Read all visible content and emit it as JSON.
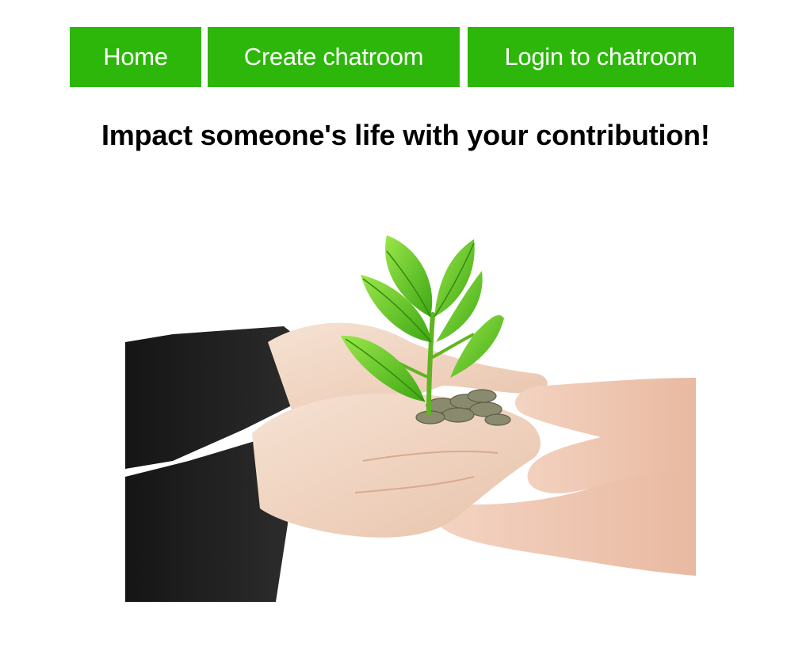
{
  "nav": {
    "items": [
      {
        "label": "Home"
      },
      {
        "label": "Create chatroom"
      },
      {
        "label": "Login to chatroom"
      }
    ]
  },
  "main": {
    "headline": "Impact someone's life with your contribution!",
    "hero_image": {
      "icon": "seedling-in-hands-illustration"
    }
  },
  "colors": {
    "nav_background": "#2db70a",
    "nav_text": "#ffffff",
    "headline": "#000000",
    "background": "#ffffff"
  }
}
